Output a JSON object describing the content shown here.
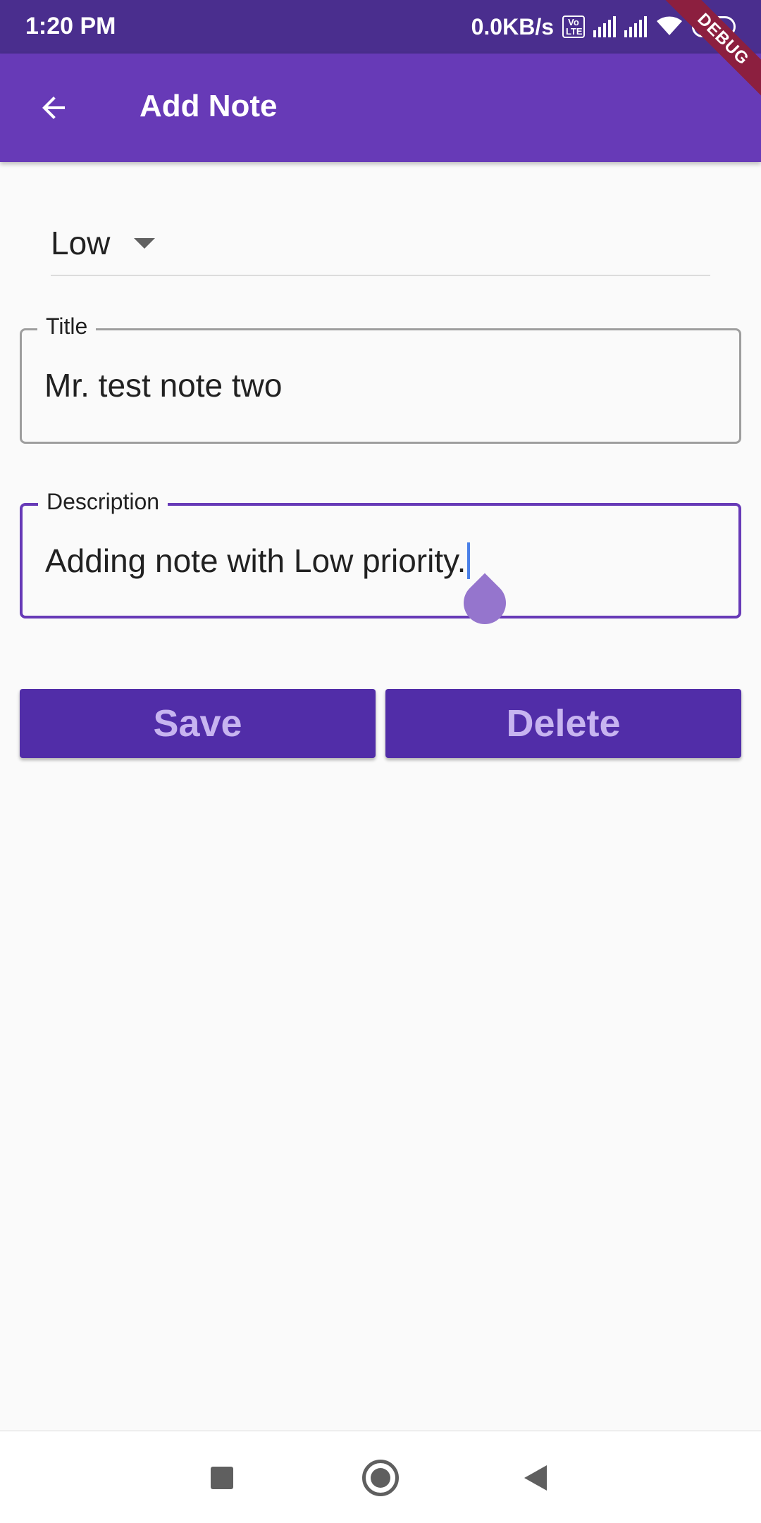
{
  "status_bar": {
    "time": "1:20 PM",
    "net_speed": "0.0KB/s",
    "volte_label": "Vo LTE",
    "battery": "22"
  },
  "debug_banner": "DEBUG",
  "app_bar": {
    "title": "Add Note",
    "back_icon": "arrow-back-icon"
  },
  "priority_dropdown": {
    "selected": "Low"
  },
  "form": {
    "title_label": "Title",
    "title_value": "Mr. test note two",
    "description_label": "Description",
    "description_value": "Adding note with Low priority."
  },
  "buttons": {
    "save_label": "Save",
    "delete_label": "Delete"
  },
  "colors": {
    "primary": "#673ab7",
    "primary_dark": "#4a2e8e",
    "button": "#512da8",
    "button_text": "#c7b4f0",
    "debug": "#8c1f3f"
  },
  "nav_icons": [
    "recents-square-icon",
    "home-circle-icon",
    "back-triangle-icon"
  ]
}
